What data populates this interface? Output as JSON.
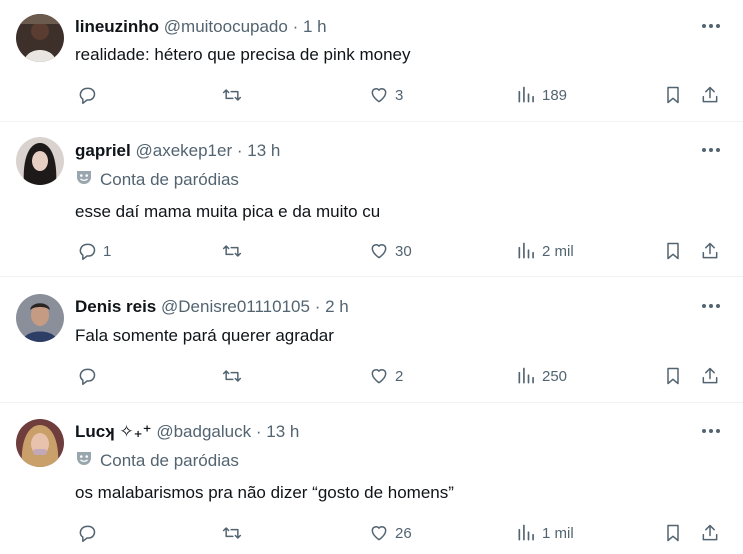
{
  "posts": [
    {
      "name": "lineuzinho",
      "handle": "@muitoocupado",
      "dot": "·",
      "time": "1 h",
      "badge": "",
      "text": "realidade: hétero que precisa de pink money",
      "replies": "",
      "reposts": "",
      "likes": "3",
      "views": "189"
    },
    {
      "name": "gapriel",
      "handle": "@axekep1er",
      "dot": "·",
      "time": "13 h",
      "badge": "Conta de paródias",
      "text": "esse daí mama muita pica e da muito cu",
      "replies": "1",
      "reposts": "",
      "likes": "30",
      "views": "2 mil"
    },
    {
      "name": "Denis reis",
      "handle": "@Denisre01110105",
      "dot": "·",
      "time": "2 h",
      "badge": "",
      "text": "Fala somente pará querer agradar",
      "replies": "",
      "reposts": "",
      "likes": "2",
      "views": "250"
    },
    {
      "name": "Lucʞ ✧₊⁺",
      "handle": "@badgaluck",
      "dot": "·",
      "time": "13 h",
      "badge": "Conta de paródias",
      "text": "os malabarismos pra não dizer “gosto de homens”",
      "replies": "",
      "reposts": "",
      "likes": "26",
      "views": "1 mil"
    }
  ],
  "icons": {
    "reply": "reply-icon",
    "repost": "repost-icon",
    "like": "heart-icon",
    "views": "views-icon",
    "bookmark": "bookmark-icon",
    "share": "share-icon",
    "more": "more-icon",
    "parody": "parody-mask-icon"
  },
  "colors": {
    "text": "#0f1419",
    "secondary": "#536471",
    "divider": "#eff3f4"
  }
}
